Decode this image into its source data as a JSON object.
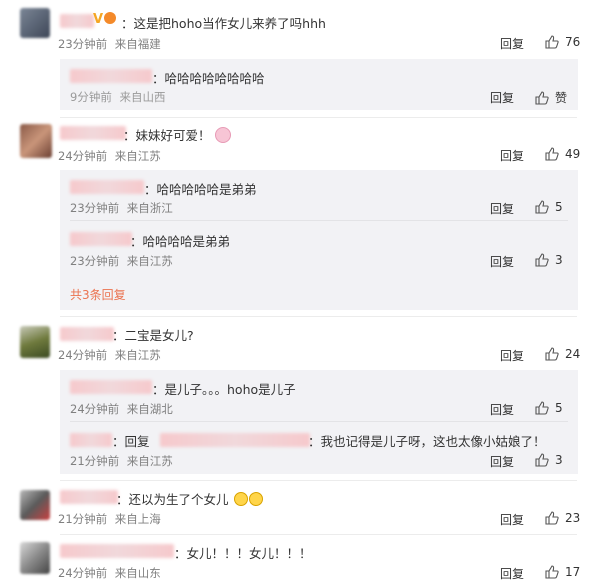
{
  "icons": {
    "like": "thumbs-up-icon"
  },
  "accent_color": "#eb7350",
  "comments": [
    {
      "text": "：这是把hoho当作女儿来养了吗hhh",
      "time": "23分钟前",
      "location": "来自福建",
      "reply_label": "回复",
      "likes": "76",
      "replies": [
        {
          "text": "：哈哈哈哈哈哈哈哈",
          "time": "9分钟前",
          "location": "来自山西",
          "reply_label": "回复",
          "likes": "赞"
        }
      ]
    },
    {
      "text": "：妹妹好可爱！",
      "time": "24分钟前",
      "location": "来自江苏",
      "reply_label": "回复",
      "likes": "49",
      "replies": [
        {
          "text": "：哈哈哈哈哈是弟弟",
          "time": "23分钟前",
          "location": "来自浙江",
          "reply_label": "回复",
          "likes": "5"
        },
        {
          "text": "：哈哈哈哈是弟弟",
          "time": "23分钟前",
          "location": "来自江苏",
          "reply_label": "回复",
          "likes": "3"
        }
      ],
      "more": "共3条回复"
    },
    {
      "text": "：二宝是女儿?",
      "time": "24分钟前",
      "location": "来自江苏",
      "reply_label": "回复",
      "likes": "24",
      "replies": [
        {
          "text": "：是儿子。。。hoho是儿子",
          "time": "24分钟前",
          "location": "来自湖北",
          "reply_label": "回复",
          "likes": "5"
        },
        {
          "text_prefix": "：回复",
          "text": "：我也记得是儿子呀，这也太像小姑娘了！",
          "time": "21分钟前",
          "location": "来自江苏",
          "reply_label": "回复",
          "likes": "3"
        }
      ]
    },
    {
      "text": "：还以为生了个女儿",
      "time": "21分钟前",
      "location": "来自上海",
      "reply_label": "回复",
      "likes": "23"
    },
    {
      "text": "：女儿！！！女儿！！！",
      "time": "24分钟前",
      "location": "来自山东",
      "reply_label": "回复",
      "likes": "17"
    }
  ]
}
